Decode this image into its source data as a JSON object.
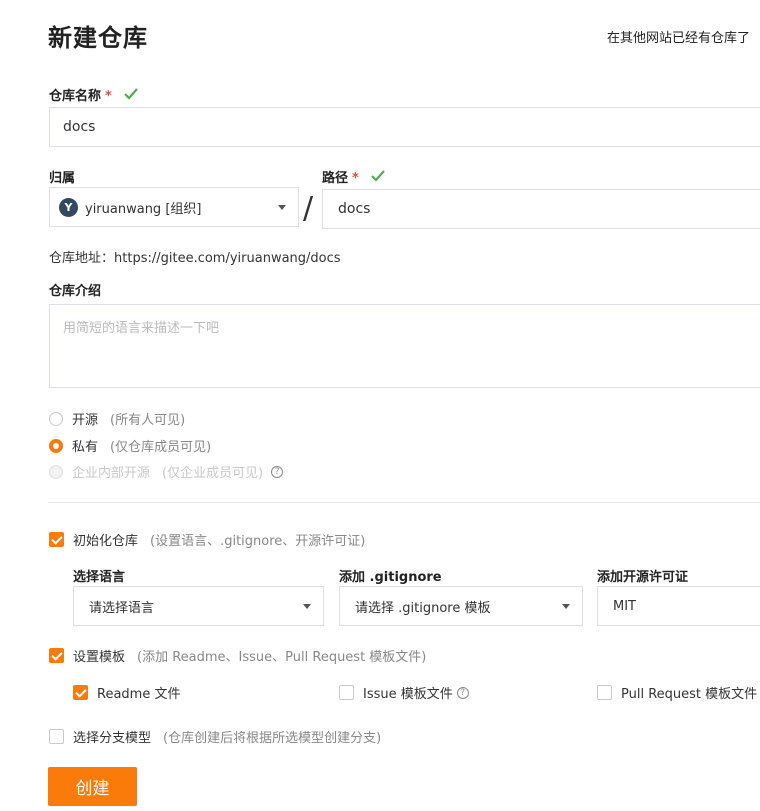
{
  "page": {
    "title": "新建仓库",
    "import_link": "在其他网站已经有仓库了"
  },
  "repo_name": {
    "label": "仓库名称",
    "required_mark": "*",
    "value": "docs"
  },
  "owner": {
    "label": "归属",
    "avatar_letter": "Y",
    "value": "yiruanwang [组织]"
  },
  "separator": "/",
  "path": {
    "label": "路径",
    "required_mark": "*",
    "value": "docs"
  },
  "repo_address": {
    "label": "仓库地址：",
    "value": "https://gitee.com/yiruanwang/docs"
  },
  "description": {
    "label": "仓库介绍",
    "placeholder": "用简短的语言来描述一下吧"
  },
  "visibility": {
    "options": [
      {
        "label": "开源",
        "hint": "(所有人可见)",
        "state": "unchecked"
      },
      {
        "label": "私有",
        "hint": "(仅仓库成员可见)",
        "state": "checked"
      },
      {
        "label": "企业内部开源",
        "hint": "(仅企业成员可见)",
        "state": "disabled",
        "help_icon": "?"
      }
    ]
  },
  "init_repo": {
    "label": "初始化仓库",
    "hint": "(设置语言、.gitignore、开源许可证)",
    "checked": true
  },
  "language": {
    "label": "选择语言",
    "value": "请选择语言"
  },
  "gitignore": {
    "label": "添加 .gitignore",
    "value": "请选择 .gitignore 模板"
  },
  "license": {
    "label": "添加开源许可证",
    "value": "MIT"
  },
  "template": {
    "label": "设置模板",
    "hint": "(添加 Readme、Issue、Pull Request 模板文件)",
    "checked": true,
    "items": [
      {
        "label": "Readme 文件",
        "checked": true
      },
      {
        "label": "Issue 模板文件",
        "checked": false,
        "help_icon": "?"
      },
      {
        "label": "Pull Request 模板文件",
        "checked": false
      }
    ]
  },
  "branch_model": {
    "label": "选择分支模型",
    "hint": "(仓库创建后将根据所选模型创建分支)",
    "checked": false
  },
  "submit": {
    "label": "创建"
  },
  "colors": {
    "accent": "#fa7a0a",
    "check_green": "#4caf50",
    "required_red": "#e74c3c"
  }
}
